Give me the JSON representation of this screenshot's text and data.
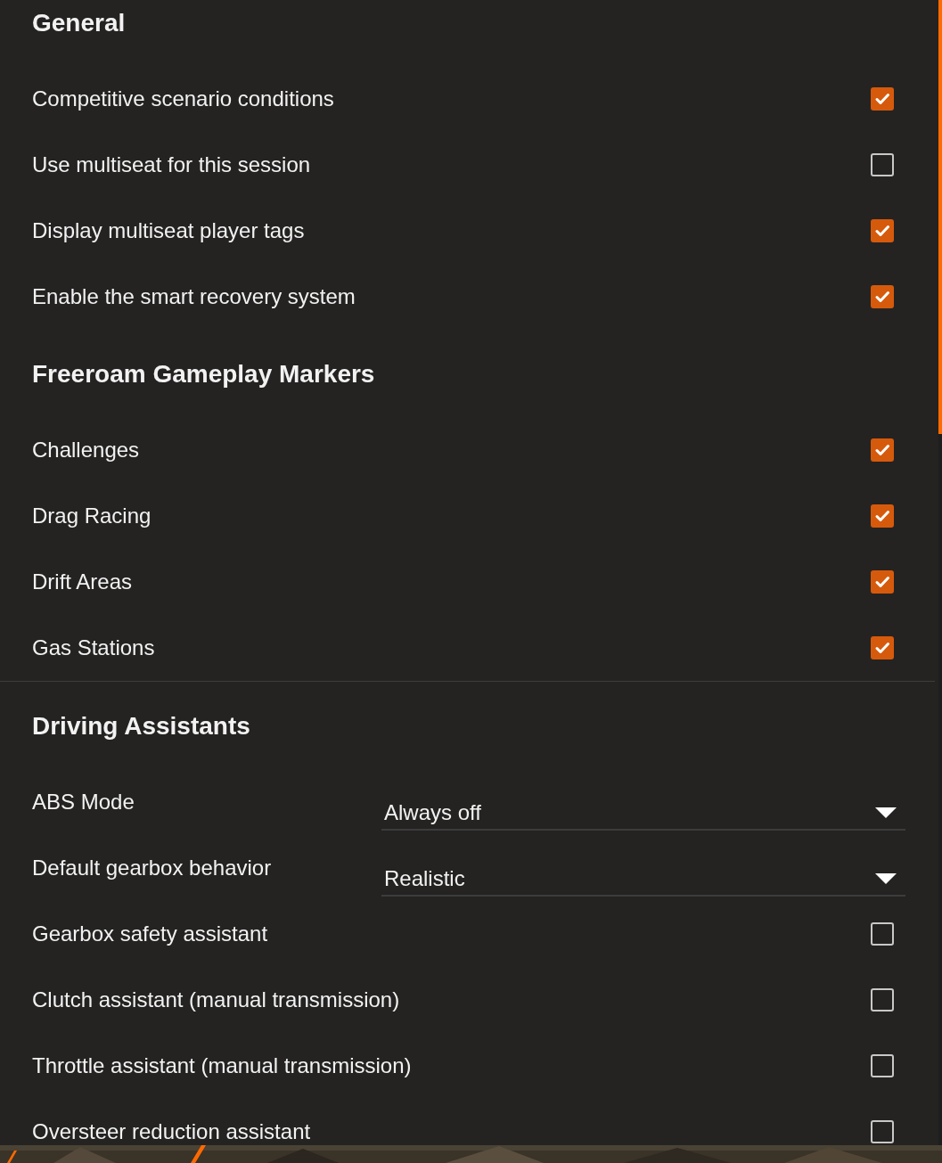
{
  "sections": [
    {
      "heading": "General",
      "divider_before": false,
      "items": [
        {
          "kind": "checkbox",
          "label": "Competitive scenario conditions",
          "checked": true
        },
        {
          "kind": "checkbox",
          "label": "Use multiseat for this session",
          "checked": false
        },
        {
          "kind": "checkbox",
          "label": "Display multiseat player tags",
          "checked": true
        },
        {
          "kind": "checkbox",
          "label": "Enable the smart recovery system",
          "checked": true
        }
      ]
    },
    {
      "heading": "Freeroam Gameplay Markers",
      "divider_before": false,
      "items": [
        {
          "kind": "checkbox",
          "label": "Challenges",
          "checked": true
        },
        {
          "kind": "checkbox",
          "label": "Drag Racing",
          "checked": true
        },
        {
          "kind": "checkbox",
          "label": "Drift Areas",
          "checked": true
        },
        {
          "kind": "checkbox",
          "label": "Gas Stations",
          "checked": true
        }
      ]
    },
    {
      "heading": "Driving Assistants",
      "divider_before": true,
      "items": [
        {
          "kind": "dropdown",
          "label": "ABS Mode",
          "value": "Always off"
        },
        {
          "kind": "dropdown",
          "label": "Default gearbox behavior",
          "value": "Realistic"
        },
        {
          "kind": "checkbox",
          "label": "Gearbox safety assistant",
          "checked": false
        },
        {
          "kind": "checkbox",
          "label": "Clutch assistant (manual transmission)",
          "checked": false
        },
        {
          "kind": "checkbox",
          "label": "Throttle assistant (manual transmission)",
          "checked": false
        },
        {
          "kind": "checkbox",
          "label": "Oversteer reduction assistant",
          "checked": false
        }
      ]
    }
  ]
}
